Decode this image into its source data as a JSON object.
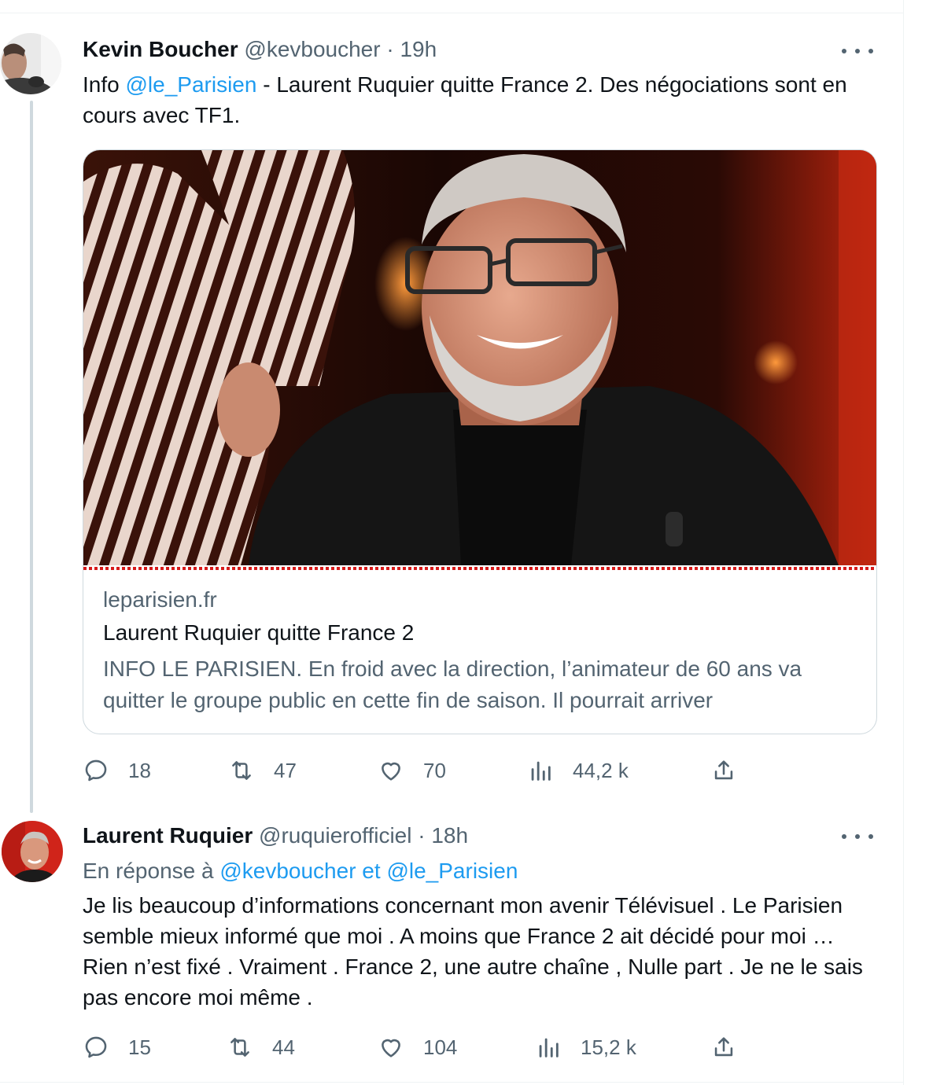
{
  "tweets": [
    {
      "name": "Kevin Boucher",
      "handle": "@kevboucher",
      "separator": "·",
      "time": "19h",
      "text_before": "Info ",
      "mention": "@le_Parisien",
      "text_after": " - Laurent Ruquier quitte France 2. Des négociations sont en cours avec TF1.",
      "card": {
        "domain": "leparisien.fr",
        "title": "Laurent Ruquier quitte France 2",
        "description": "INFO LE PARISIEN. En froid avec la direction, l’animateur de 60 ans va quitter le groupe public en cette fin de saison. Il pourrait arriver"
      },
      "stats": {
        "replies": "18",
        "retweets": "47",
        "likes": "70",
        "views": "44,2 k"
      }
    },
    {
      "name": "Laurent Ruquier",
      "handle": "@ruquierofficiel",
      "separator": "·",
      "time": "18h",
      "reply_prefix": "En réponse à ",
      "reply_mention_1": "@kevboucher",
      "reply_and": " et ",
      "reply_mention_2": "@le_Parisien",
      "text": "Je lis beaucoup d’informations concernant mon avenir Télévisuel . Le Parisien semble mieux informé que moi . A moins que France 2 ait décidé pour moi … Rien n’est fixé . Vraiment . France 2, une autre chaîne , Nulle part . Je ne le sais pas encore moi même .",
      "stats": {
        "replies": "15",
        "retweets": "44",
        "likes": "104",
        "views": "15,2 k"
      }
    }
  ],
  "colors": {
    "accent": "#1d9bf0",
    "secondary_text": "#536471",
    "border": "#cfd9de",
    "card_accent": "#d61a1a"
  },
  "icons": [
    "more-icon",
    "reply-icon",
    "retweet-icon",
    "like-icon",
    "views-icon",
    "share-icon"
  ]
}
